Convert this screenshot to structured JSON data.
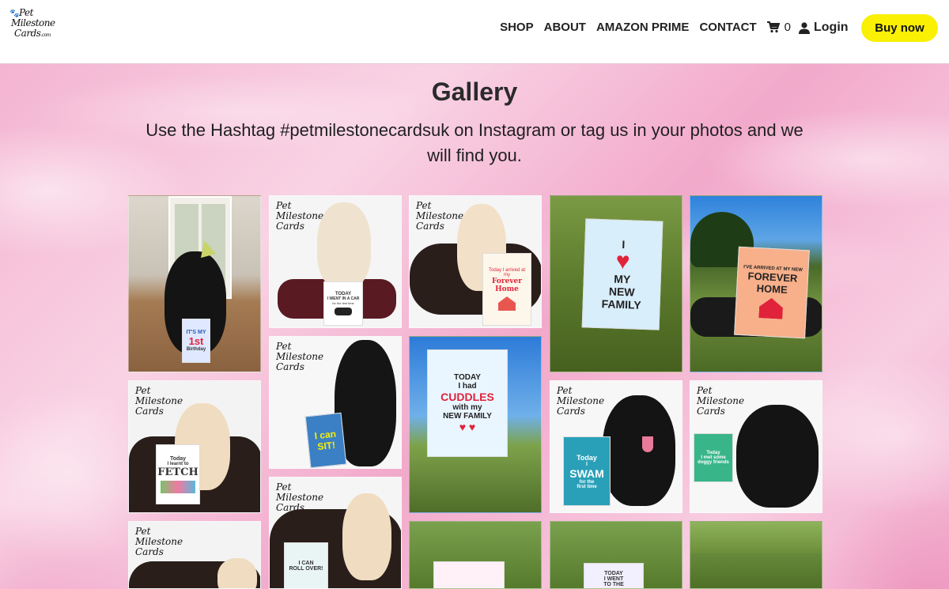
{
  "header": {
    "logo_lines": [
      "Pet",
      "Milestone",
      "Cards"
    ],
    "logo_suffix": ".com",
    "nav": [
      "SHOP",
      "ABOUT",
      "AMAZON PRIME",
      "CONTACT"
    ],
    "cart_count": "0",
    "login_label": "Login",
    "buy_label": "Buy now"
  },
  "page": {
    "title": "Gallery",
    "subtitle": "Use the Hashtag #petmilestonecardsuk on Instagram or tag us in your photos and we will find you."
  },
  "watermark": [
    "Pet",
    "Milestone",
    "Cards"
  ],
  "cards": {
    "birthday": [
      "IT'S MY",
      "1st",
      "Birthday"
    ],
    "car": [
      "TODAY",
      "I WENT IN A CAR",
      "for the first time"
    ],
    "forever_home_small": [
      "Today I arrived at my",
      "Forever Home"
    ],
    "family": [
      "I",
      "MY",
      "NEW",
      "FAMILY"
    ],
    "forever_home": [
      "I'VE ARRIVED AT MY NEW",
      "FOREVER",
      "HOME"
    ],
    "sit": [
      "I can",
      "SIT!"
    ],
    "cuddles": [
      "TODAY",
      "I had",
      "CUDDLES",
      "with my",
      "NEW FAMILY"
    ],
    "fetch": [
      "Today",
      "I learnt to",
      "FETCH"
    ],
    "swam": [
      "Today",
      "I",
      "SWAM",
      "for the",
      "first time"
    ],
    "friends": [
      "Today",
      "I met some",
      "doggy friends"
    ],
    "rollover": [
      "I CAN",
      "ROLL OVER!"
    ],
    "went": [
      "TODAY",
      "I WENT",
      "TO THE"
    ]
  },
  "colors": {
    "accent": "#f9f003",
    "background": "#f6c7dd",
    "heart": "#e0233a"
  },
  "icons": {
    "cart": "cart-icon",
    "login": "user-icon",
    "paw": "paw-icon"
  }
}
